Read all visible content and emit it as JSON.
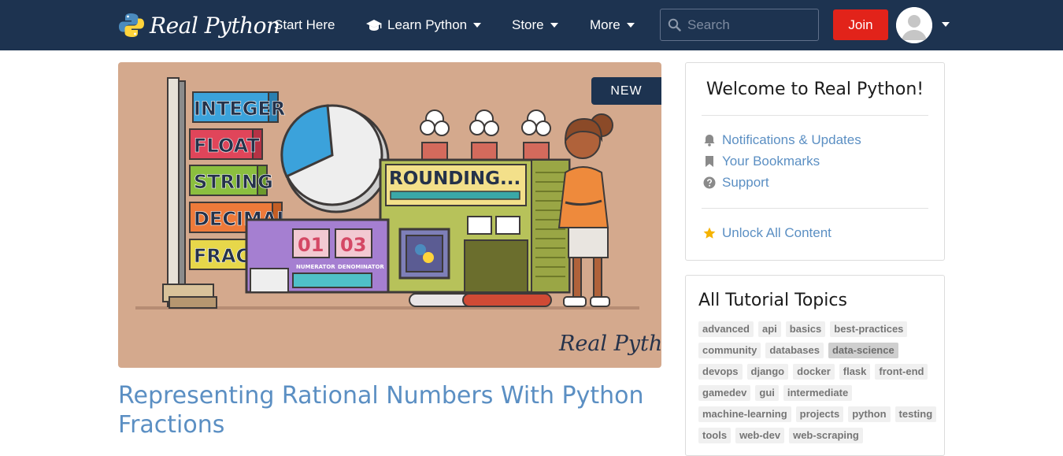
{
  "brand": {
    "name": "Real Python"
  },
  "nav": {
    "start_here": "Start Here",
    "learn_python": "Learn Python",
    "store": "Store",
    "more": "More"
  },
  "search": {
    "placeholder": "Search",
    "value": ""
  },
  "join_label": "Join",
  "article": {
    "badge": "NEW",
    "title": "Representing Rational Numbers With Python Fractions",
    "image_labels": [
      "INTEGER",
      "FLOAT",
      "STRING",
      "DECIMAL",
      "FRACTION",
      "ROUNDING...",
      "01",
      "03",
      "NUMERATOR",
      "DENOMINATOR",
      "Real Python"
    ]
  },
  "sidebar": {
    "welcome_title": "Welcome to Real Python!",
    "links": [
      {
        "label": "Notifications & Updates",
        "icon": "bell-icon"
      },
      {
        "label": "Your Bookmarks",
        "icon": "bookmark-icon"
      },
      {
        "label": "Support",
        "icon": "question-circle-icon"
      }
    ],
    "unlock": {
      "label": "Unlock All Content",
      "icon": "star-icon"
    },
    "topics_title": "All Tutorial Topics",
    "tags": [
      "advanced",
      "api",
      "basics",
      "best-practices",
      "community",
      "databases",
      "data-science",
      "devops",
      "django",
      "docker",
      "flask",
      "front-end",
      "gamedev",
      "gui",
      "intermediate",
      "machine-learning",
      "projects",
      "python",
      "testing",
      "tools",
      "web-dev",
      "web-scraping"
    ],
    "active_tag": "data-science"
  },
  "colors": {
    "navbar": "#1d3350",
    "link": "#5b8fc3",
    "join": "#e2231a",
    "star": "#f5b301",
    "hero_bg": "#d4a98d"
  }
}
